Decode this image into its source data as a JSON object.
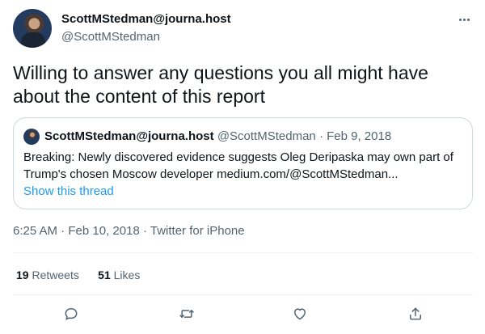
{
  "author": {
    "display_name": "ScottMStedman@journa.host",
    "handle": "@ScottMStedman"
  },
  "tweet": {
    "text": "Willing to answer any questions you all might have about the content of this report"
  },
  "quoted_tweet": {
    "display_name": "ScottMStedman@journa.host",
    "handle": "@ScottMStedman",
    "separator": "·",
    "date": "Feb 9, 2018",
    "text": "Breaking: Newly discovered evidence suggests Oleg Deripaska may own part of Trump's chosen Moscow developer medium.com/@ScottMStedman...",
    "show_thread_label": "Show this thread"
  },
  "meta": {
    "time": "6:25 AM",
    "separator": "·",
    "date": "Feb 10, 2018",
    "source": "Twitter for iPhone"
  },
  "stats": {
    "retweets_count": "19",
    "retweets_label": "Retweets",
    "likes_count": "51",
    "likes_label": "Likes"
  },
  "icons": [
    "more-icon",
    "reply-icon",
    "retweet-icon",
    "like-icon",
    "share-icon"
  ],
  "colors": {
    "text_primary": "#0f1419",
    "text_secondary": "#536471",
    "link": "#1d9bf0",
    "border": "#cfd9de"
  }
}
